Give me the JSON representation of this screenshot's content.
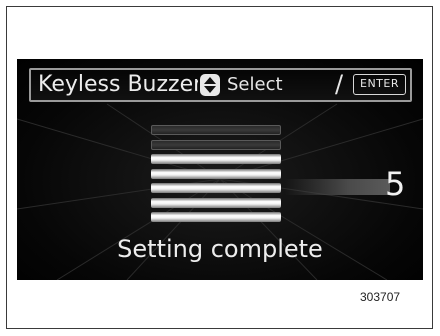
{
  "header": {
    "title": "Keyless Buzzer Volume",
    "select_label": "Select",
    "separator": "/",
    "enter_label": "ENTER",
    "updown_icon": "up-down-arrows-icon"
  },
  "setting": {
    "value": "5",
    "level": 5,
    "max_level": 7
  },
  "status": {
    "message": "Setting complete"
  },
  "figure": {
    "id": "303707"
  },
  "colors": {
    "screen_bg": "#000000",
    "text": "#ececec",
    "bar_on": "#f2f2f2",
    "bar_off": "#333333"
  }
}
